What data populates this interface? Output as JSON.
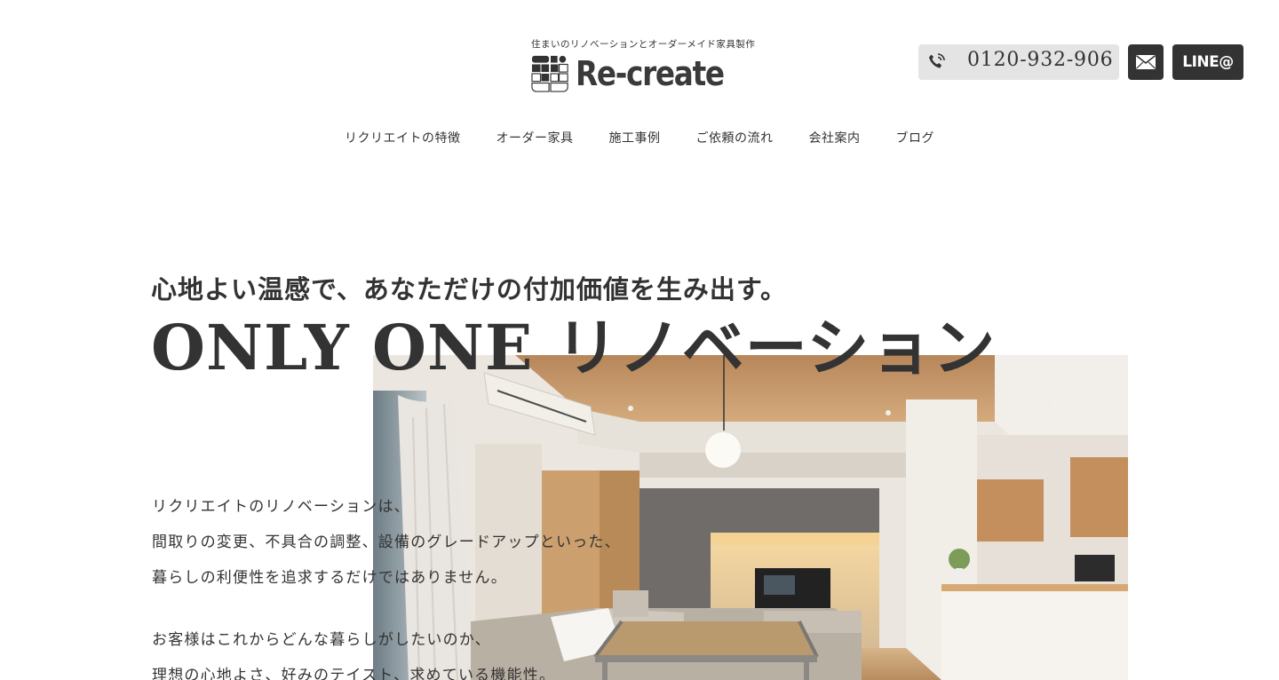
{
  "header": {
    "tagline": "住まいのリノベーションとオーダーメイド家具製作",
    "logo_text": "Re-create",
    "phone_number": "0120-932-906",
    "line_label": "LINE@"
  },
  "nav": {
    "items": [
      {
        "label": "リクリエイトの特徴"
      },
      {
        "label": "オーダー家具"
      },
      {
        "label": "施工事例"
      },
      {
        "label": "ご依頼の流れ"
      },
      {
        "label": "会社案内"
      },
      {
        "label": "ブログ"
      }
    ]
  },
  "hero": {
    "subtitle": "心地よい温感で、あなただけの付加価値を生み出す。",
    "title": "ONLY ONE リノベーション",
    "paragraph1": [
      "リクリエイトのリノベーションは、",
      "間取りの変更、不具合の調整、設備のグレードアップといった、",
      "暮らしの利便性を追求するだけではありません。"
    ],
    "paragraph2": [
      "お客様はこれからどんな暮らしがしたいのか、",
      "理想の心地よさ、好みのテイスト、求めている機能性。"
    ]
  },
  "colors": {
    "text": "#333333",
    "phone_bg": "#e4e4e4",
    "button_dark": "#333333"
  },
  "icons": {
    "phone": "phone-icon",
    "mail": "mail-icon"
  }
}
